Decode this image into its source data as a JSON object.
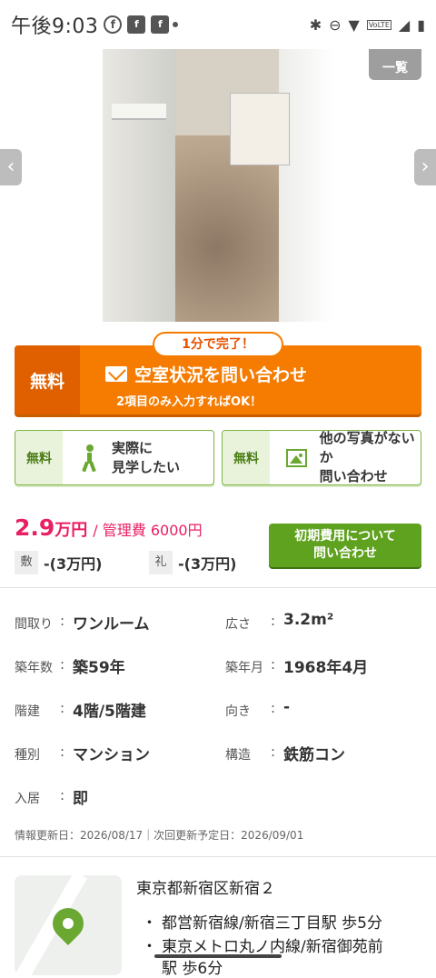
{
  "status_bar": {
    "time": "午後9:03",
    "lte": "VoLTE"
  },
  "gallery": {
    "list_label": "一覧",
    "prev_arrow": "‹",
    "next_arrow": "›"
  },
  "cta": {
    "badge": "1分で完了！",
    "free_label": "無料",
    "title": "空室状況を問い合わせ",
    "subtitle": "2項目のみ入力すればOK！",
    "color": "#f57c00"
  },
  "sub_buttons": [
    {
      "free_label": "無料",
      "label_line1": "実際に",
      "label_line2": "見学したい",
      "icon": "walk-icon"
    },
    {
      "free_label": "無料",
      "label_line1": "他の写真がないか",
      "label_line2": "問い合わせ",
      "icon": "image-icon"
    }
  ],
  "price": {
    "rent": "2.9",
    "rent_unit": "万円",
    "fee": "/ 管理費 6000円",
    "deposit_tag": "敷",
    "deposit": "-(3万円)",
    "key_money_tag": "礼",
    "key_money": "-(3万円)",
    "accent": "#e91e63"
  },
  "initial_cost_button": {
    "line1": "初期費用について",
    "line2": "問い合わせ"
  },
  "specs": [
    {
      "label": "間取り",
      "value": "ワンルーム",
      "label2": "広さ",
      "value2": "3.2m²"
    },
    {
      "label": "築年数",
      "value": "築59年",
      "label2": "築年月",
      "value2": "1968年4月"
    },
    {
      "label": "階建",
      "value": "4階/5階建",
      "label2": "向き",
      "value2": "-"
    },
    {
      "label": "種別",
      "value": "マンション",
      "label2": "構造",
      "value2": "鉄筋コン"
    },
    {
      "label": "入居",
      "value": "即"
    }
  ],
  "updated": "情報更新日：2026/08/17｜次回更新予定日：2026/09/01",
  "location": {
    "address": "東京都新宿区新宿２",
    "stations": [
      "都営新宿線/新宿三丁目駅 歩5分",
      "東京メトロ丸ノ内線/新宿御苑前",
      "駅 歩6分"
    ]
  }
}
